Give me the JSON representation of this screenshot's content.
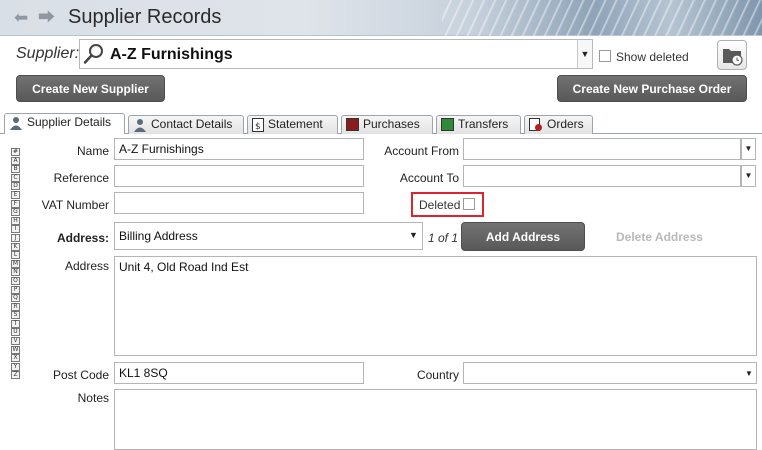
{
  "window": {
    "title": "Supplier Records"
  },
  "supplier": {
    "label": "Supplier:",
    "value": "A-Z Furnishings",
    "show_deleted_label": "Show deleted",
    "show_deleted_checked": false
  },
  "buttons": {
    "create_supplier": "Create New Supplier",
    "create_po": "Create New Purchase Order",
    "add_address": "Add Address",
    "delete_address": "Delete Address"
  },
  "tabs": [
    {
      "label": "Supplier Details",
      "icon": "person-icon",
      "active": true
    },
    {
      "label": "Contact Details",
      "icon": "person-icon",
      "active": false
    },
    {
      "label": "Statement",
      "icon": "statement-icon",
      "active": false
    },
    {
      "label": "Purchases",
      "icon": "purchases-icon",
      "active": false
    },
    {
      "label": "Transfers",
      "icon": "transfers-icon",
      "active": false
    },
    {
      "label": "Orders",
      "icon": "orders-icon",
      "active": false
    }
  ],
  "alphabet": [
    "#",
    "A",
    "B",
    "C",
    "D",
    "E",
    "F",
    "G",
    "H",
    "I",
    "J",
    "K",
    "L",
    "M",
    "N",
    "O",
    "P",
    "Q",
    "R",
    "S",
    "T",
    "U",
    "V",
    "W",
    "X",
    "Y",
    "Z"
  ],
  "form": {
    "name_label": "Name",
    "name_value": "A-Z Furnishings",
    "reference_label": "Reference",
    "reference_value": "",
    "vat_label": "VAT Number",
    "vat_value": "",
    "account_from_label": "Account From",
    "account_from_value": "",
    "account_to_label": "Account To",
    "account_to_value": "",
    "deleted_label": "Deleted",
    "address_select_label": "Address:",
    "address_select_value": "Billing Address",
    "address_pager": "1 of 1",
    "address_label": "Address",
    "address_value": "Unit 4, Old Road Ind Est",
    "postcode_label": "Post Code",
    "postcode_value": "KL1 8SQ",
    "country_label": "Country",
    "country_value": "",
    "notes_label": "Notes",
    "notes_value": ""
  },
  "colors": {
    "button_bg": "#666666",
    "highlight_border": "#d9262c",
    "tab_border": "#9aa5b1"
  }
}
